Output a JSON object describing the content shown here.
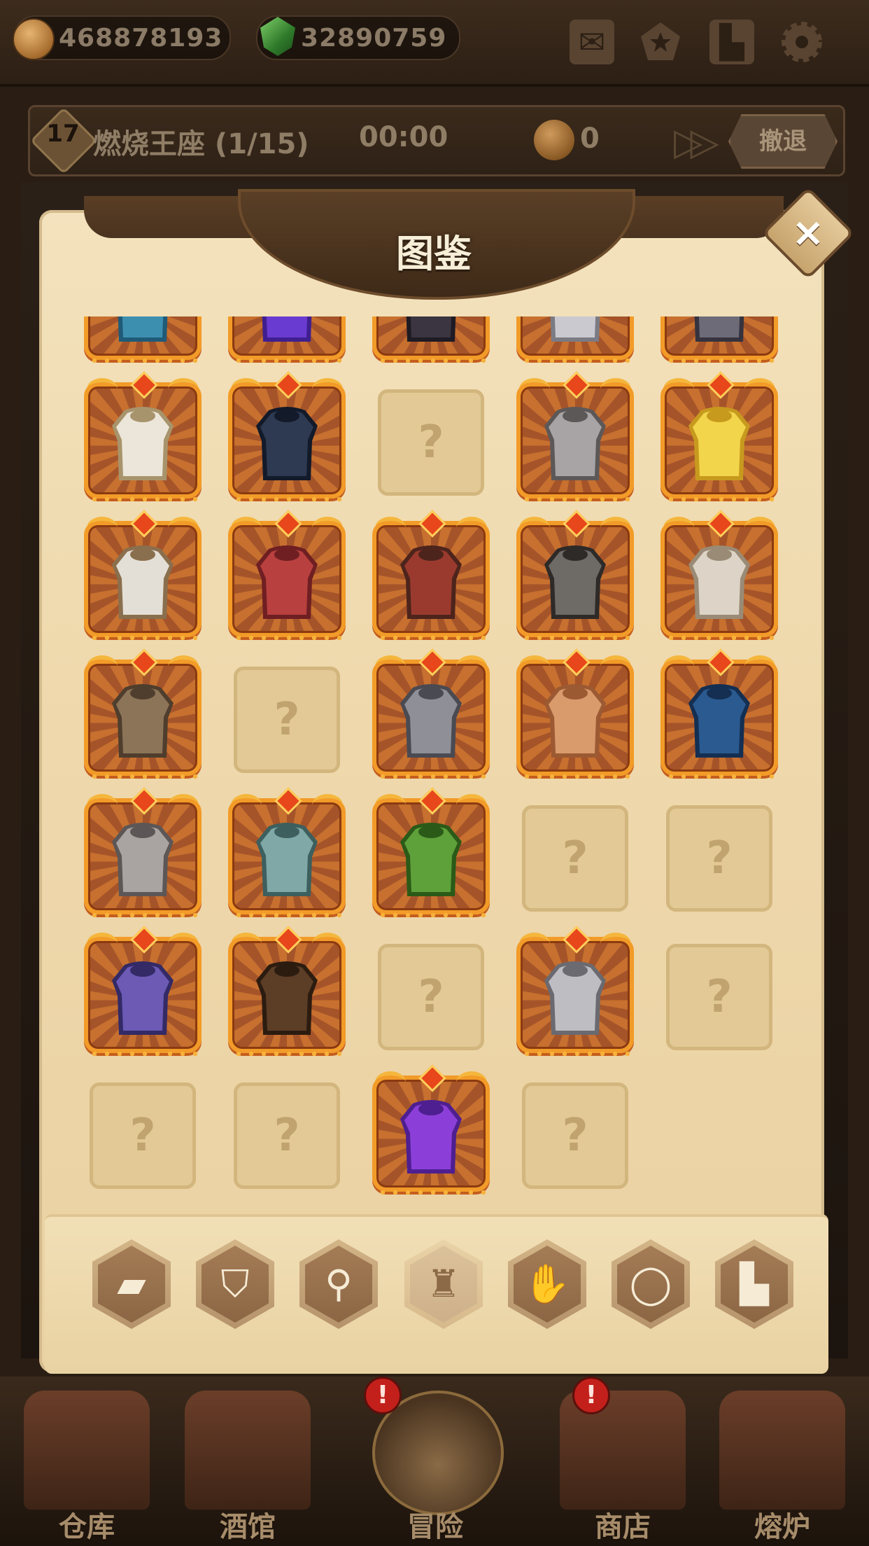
{
  "resources": {
    "gold": "468878193",
    "gems": "32890759"
  },
  "top_icons": [
    "mail-icon",
    "favorites-icon",
    "book-icon",
    "settings-icon"
  ],
  "stage": {
    "level": "17",
    "name": "燃烧王座 (1/15)",
    "timer": "00:00",
    "coins": "0",
    "retreat_label": "撤退"
  },
  "dialog": {
    "title": "图鉴",
    "close_label": "×"
  },
  "grid": {
    "rows": [
      [
        "teal-cloak",
        "purple-fur-cloak",
        "black-armor",
        "silver-plate",
        "dark-plate"
      ],
      [
        "white-tunic",
        "dark-fur-cloak",
        "?",
        "steel-cuirass",
        "yellow-cape"
      ],
      [
        "white-hood-tunic",
        "red-hood",
        "red-doublet",
        "chainmail-vest",
        "torn-white-robe"
      ],
      [
        "leather-jerkin",
        "?",
        "hooded-mail",
        "brown-rag",
        "blue-cape"
      ],
      [
        "iron-cuirass",
        "teal-plate",
        "green-hood",
        "?",
        "?"
      ],
      [
        "purple-hood",
        "brown-robe",
        "?",
        "silver-chestplate",
        "?"
      ],
      [
        "?",
        "?",
        "purple-robe",
        "?"
      ]
    ]
  },
  "category_tabs": [
    {
      "icon": "book-icon",
      "active": false
    },
    {
      "icon": "helmet-icon",
      "active": false
    },
    {
      "icon": "amulet-icon",
      "active": false
    },
    {
      "icon": "chest-armor-icon",
      "active": true
    },
    {
      "icon": "glove-icon",
      "active": false
    },
    {
      "icon": "ring-icon",
      "active": false
    },
    {
      "icon": "boot-icon",
      "active": false
    }
  ],
  "bottom_nav": [
    {
      "label": "仓库",
      "alert": false
    },
    {
      "label": "酒馆",
      "alert": false
    },
    {
      "label": "冒险",
      "alert": true,
      "active": true
    },
    {
      "label": "商店",
      "alert": true
    },
    {
      "label": "熔炉",
      "alert": false
    }
  ],
  "alert_glyph": "!",
  "colors": {
    "parchment": "#efd9ad",
    "frame_orange": "#f29b28",
    "dark_wood": "#3e2a18"
  }
}
